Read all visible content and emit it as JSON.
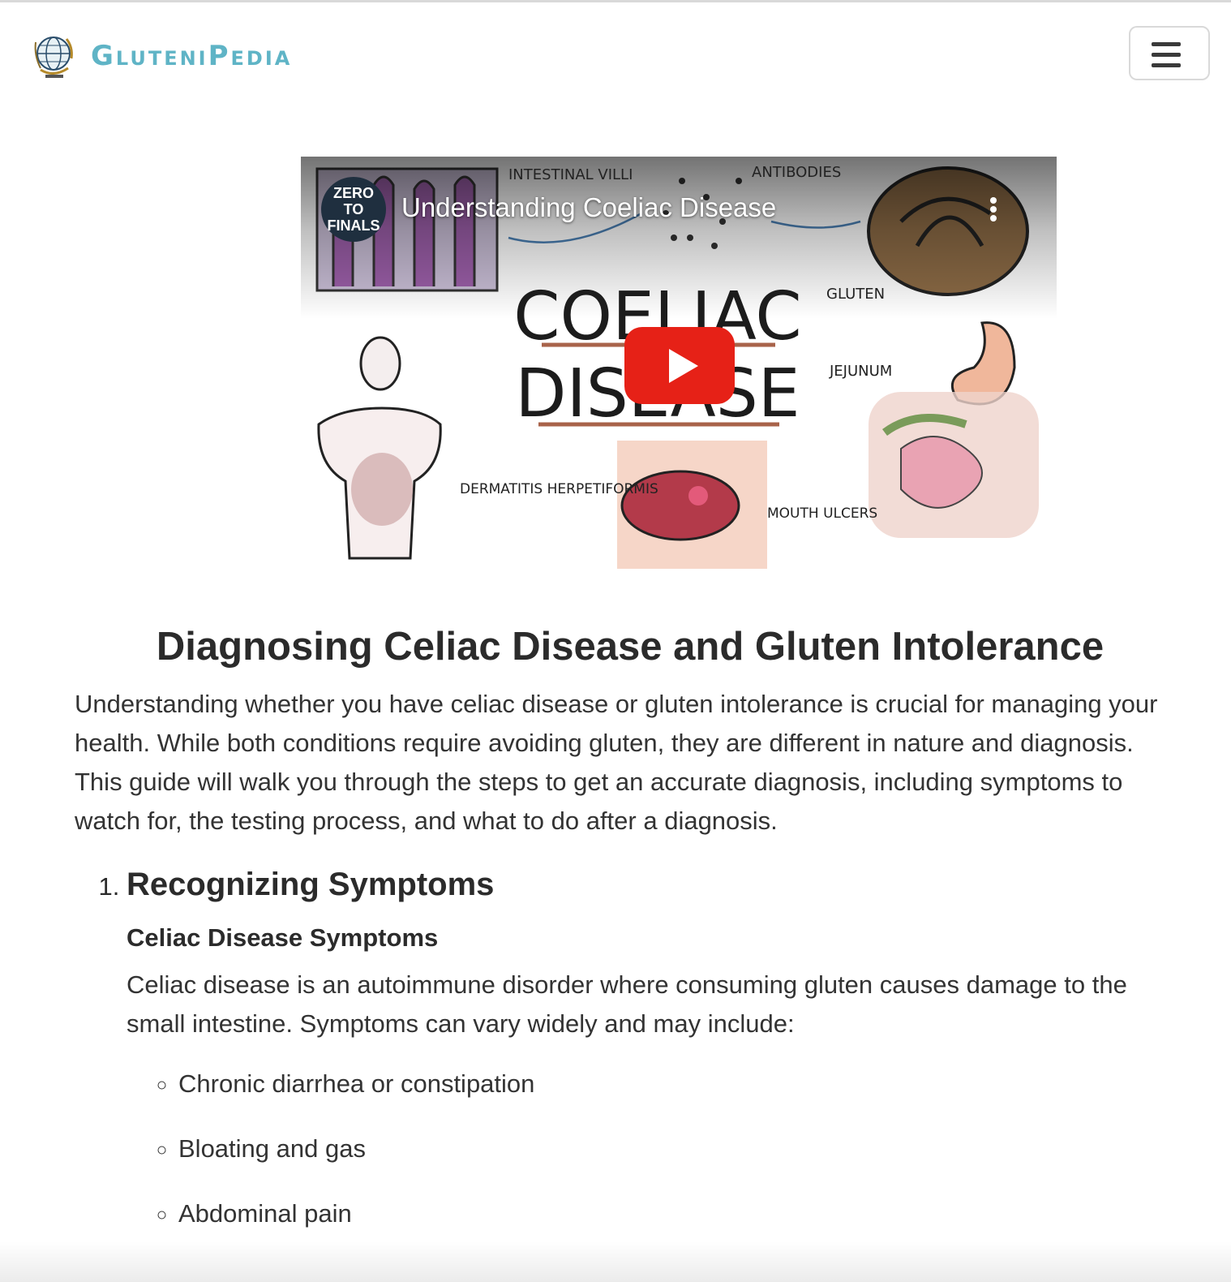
{
  "brand": {
    "name": "GluteniPedia",
    "logo_icon": "globe-wheat-icon"
  },
  "nav": {
    "toggle_icon": "hamburger-menu-icon"
  },
  "video": {
    "title": "Understanding Coeliac Disease",
    "channel": [
      "ZERO",
      "TO",
      "FINALS"
    ],
    "thumbnail_labels": {
      "villi": "INTESTINAL VILLI",
      "antibodies": "ANTIBODIES",
      "gluten": "GLUTEN",
      "heading_line1": "COELIAC",
      "heading_line2": "DISEASE",
      "jejunum": "JEJUNUM",
      "dermatitis": "DERMATITIS HERPETIFORMIS",
      "mouth": "MOUTH ULCERS"
    },
    "play_icon": "youtube-play-icon",
    "menu_icon": "more-vertical-icon",
    "colors": {
      "play": "#e62117"
    }
  },
  "article": {
    "title": "Diagnosing Celiac Disease and Gluten Intolerance",
    "intro": "Understanding whether you have celiac disease or gluten intolerance is crucial for managing your health. While both conditions require avoiding gluten, they are different in nature and diagnosis. This guide will walk you through the steps to get an accurate diagnosis, including symptoms to watch for, the testing process, and what to do after a diagnosis.",
    "sections": [
      {
        "heading": "Recognizing Symptoms",
        "subheading": "Celiac Disease Symptoms",
        "body": "Celiac disease is an autoimmune disorder where consuming gluten causes damage to the small intestine. Symptoms can vary widely and may include:",
        "items": [
          "Chronic diarrhea or constipation",
          "Bloating and gas",
          "Abdominal pain"
        ]
      }
    ]
  },
  "colors": {
    "brand": "#5fb4c6",
    "text": "#333333"
  }
}
